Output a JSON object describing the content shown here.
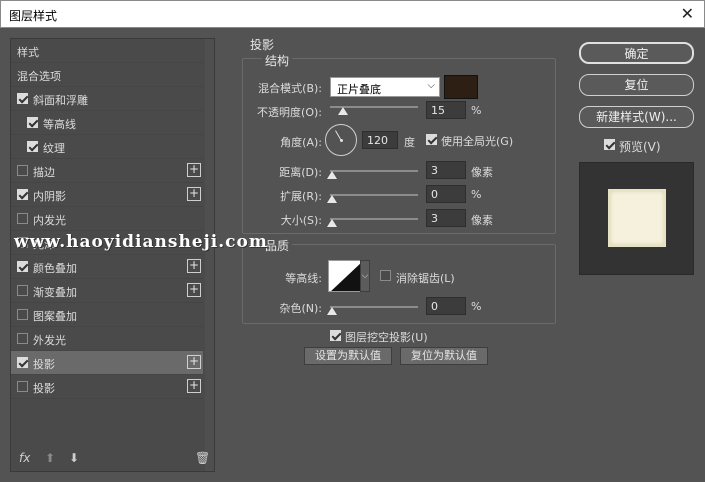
{
  "window": {
    "title": "图层样式",
    "close_glyph": "✕"
  },
  "sidebar": {
    "items": [
      {
        "label": "样式",
        "checkbox": null,
        "plus": false,
        "indent": 0,
        "selected": false
      },
      {
        "label": "混合选项",
        "checkbox": null,
        "plus": false,
        "indent": 0,
        "selected": false
      },
      {
        "label": "斜面和浮雕",
        "checkbox": true,
        "plus": false,
        "indent": 0,
        "selected": false
      },
      {
        "label": "等高线",
        "checkbox": true,
        "plus": false,
        "indent": 1,
        "selected": false
      },
      {
        "label": "纹理",
        "checkbox": true,
        "plus": false,
        "indent": 1,
        "selected": false
      },
      {
        "label": "描边",
        "checkbox": false,
        "plus": true,
        "indent": 0,
        "selected": false
      },
      {
        "label": "内阴影",
        "checkbox": true,
        "plus": true,
        "indent": 0,
        "selected": false
      },
      {
        "label": "内发光",
        "checkbox": false,
        "plus": false,
        "indent": 0,
        "selected": false
      },
      {
        "label": "光泽",
        "checkbox": false,
        "plus": false,
        "indent": 0,
        "selected": false
      },
      {
        "label": "颜色叠加",
        "checkbox": true,
        "plus": true,
        "indent": 0,
        "selected": false
      },
      {
        "label": "渐变叠加",
        "checkbox": false,
        "plus": true,
        "indent": 0,
        "selected": false
      },
      {
        "label": "图案叠加",
        "checkbox": false,
        "plus": false,
        "indent": 0,
        "selected": false
      },
      {
        "label": "外发光",
        "checkbox": false,
        "plus": false,
        "indent": 0,
        "selected": false
      },
      {
        "label": "投影",
        "checkbox": true,
        "plus": true,
        "indent": 0,
        "selected": true
      },
      {
        "label": "投影",
        "checkbox": false,
        "plus": true,
        "indent": 0,
        "selected": false
      }
    ],
    "bottom": {
      "fx": "fx",
      "up": "⬆",
      "down": "⬇",
      "trash": "🗑"
    }
  },
  "panel": {
    "section_title": "投影",
    "structure_title": "结构",
    "blend_mode_label": "混合模式(B):",
    "blend_mode_value": "正片叠底",
    "shadow_color": "#2d1f14",
    "opacity_label": "不透明度(O):",
    "opacity_value": "15",
    "opacity_fraction": 0.15,
    "opacity_unit": "%",
    "angle_label": "角度(A):",
    "angle_value": "120",
    "angle_unit": "度",
    "global_light_label": "使用全局光(G)",
    "global_light_checked": true,
    "distance_label": "距离(D):",
    "distance_value": "3",
    "distance_unit": "像素",
    "spread_label": "扩展(R):",
    "spread_value": "0",
    "spread_unit": "%",
    "size_label": "大小(S):",
    "size_value": "3",
    "size_unit": "像素",
    "quality_title": "品质",
    "contour_label": "等高线:",
    "antialias_label": "消除锯齿(L)",
    "antialias_checked": false,
    "noise_label": "杂色(N):",
    "noise_value": "0",
    "noise_unit": "%",
    "knockout_label": "图层挖空投影(U)",
    "knockout_checked": true,
    "make_default_label": "设置为默认值",
    "reset_default_label": "复位为默认值"
  },
  "actions": {
    "ok_label": "确定",
    "reset_label": "复位",
    "new_style_label": "新建样式(W)...",
    "preview_label": "预览(V)",
    "preview_checked": true,
    "preview_color": "#f5f1dc"
  },
  "watermark": "www.haoyidiansheji.com"
}
